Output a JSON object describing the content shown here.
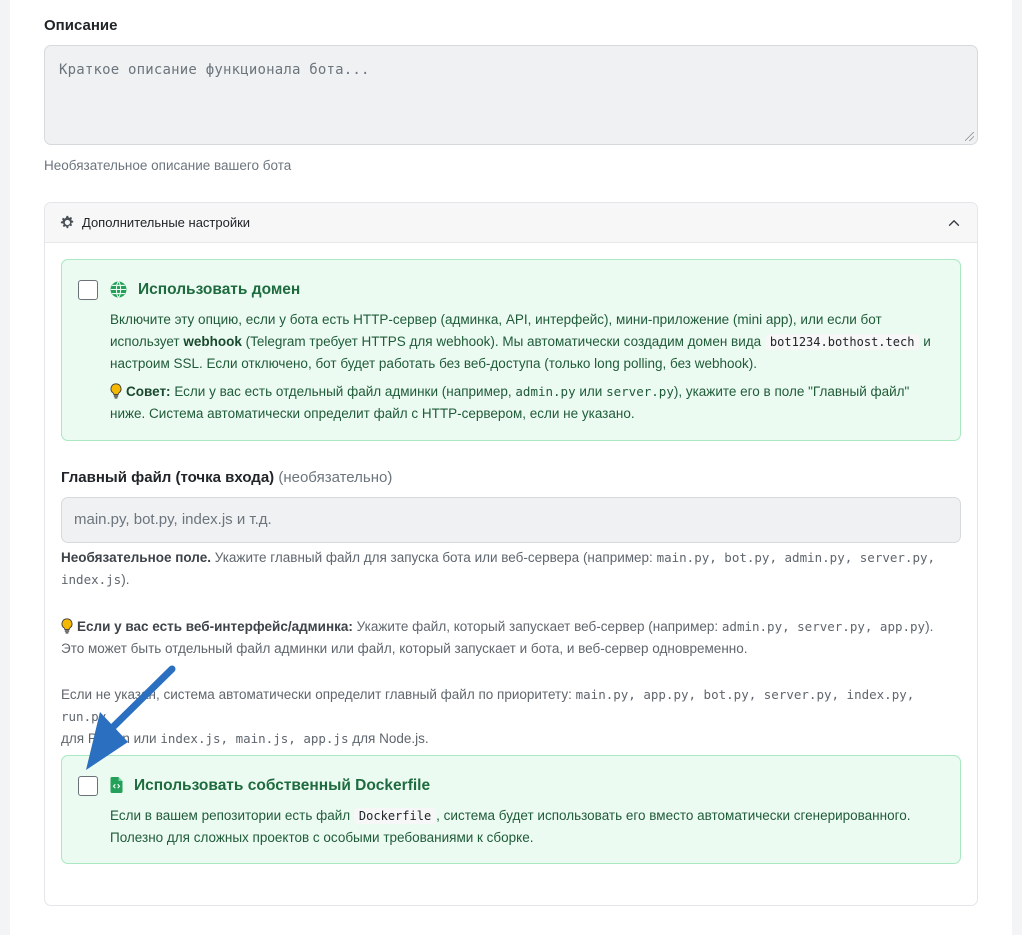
{
  "description": {
    "label": "Описание",
    "placeholder": "Краткое описание функционала бота...",
    "help": "Необязательное описание вашего бота"
  },
  "advanced": {
    "title": "Дополнительные настройки",
    "icon": "gear-icon",
    "toggle_icon": "chevron-up-icon"
  },
  "domain_option": {
    "title": "Использовать домен",
    "icon": "globe-icon",
    "p1_a": "Включите эту опцию, если у бота есть HTTP-сервер (админка, API, интерфейс), мини-приложение (mini app), или если бот",
    "p1_b": "использует",
    "p1_webhook": "webhook",
    "p1_c": "(Telegram требует HTTPS для webhook). Мы автоматически создадим домен вида",
    "p1_code": "bot1234.bothost.tech",
    "p1_d": "и",
    "p1_e": "настроим SSL. Если отключено, бот будет работать без веб-доступа (только long polling, без webhook).",
    "tip_label": "Совет:",
    "tip_a": "Если у вас есть отдельный файл админки (например,",
    "tip_code1": "admin.py",
    "tip_b": "или",
    "tip_code2": "server.py",
    "tip_c": "), укажите его в поле \"Главный файл\"",
    "tip_d": "ниже. Система автоматически определит файл с HTTP-сервером, если не указано."
  },
  "main_file": {
    "label": "Главный файл (точка входа)",
    "optional": "(необязательно)",
    "placeholder": "main.py, bot.py, index.js и т.д.",
    "h1_bold": "Необязательное поле.",
    "h1_a": "Укажите главный файл для запуска бота или веб-сервера (например:",
    "h1_files": "main.py, bot.py, admin.py, server.py,",
    "h1_files2": "index.js",
    "h1_end": ").",
    "h2_bold": "Если у вас есть веб-интерфейс/админка:",
    "h2_a": "Укажите файл, который запускает веб-сервер (например:",
    "h2_files": "admin.py, server.py, app.py",
    "h2_end": ").",
    "h2_b": "Это может быть отдельный файл админки или файл, который запускает и бота, и веб-сервер одновременно.",
    "h3_a": "Если не указан, система автоматически определит главный файл по приоритету:",
    "h3_files": "main.py, app.py, bot.py, server.py, index.py, run.py",
    "h3_b": "для Python или",
    "h3_files2": "index.js, main.js, app.js",
    "h3_c": "для Node.js."
  },
  "dockerfile_option": {
    "title": "Использовать собственный Dockerfile",
    "icon": "file-code-icon",
    "p_a": "Если в вашем репозитории есть файл",
    "p_code": "Dockerfile",
    "p_b": ", система будет использовать его вместо автоматически сгенерированного.",
    "p_c": "Полезно для сложных проектов с особыми требованиями к сборке."
  },
  "colors": {
    "accent_green": "#1e6b3f",
    "box_bg": "#ecfbf1",
    "box_border": "#a9e8c1",
    "arrow": "#2a6fc0"
  }
}
